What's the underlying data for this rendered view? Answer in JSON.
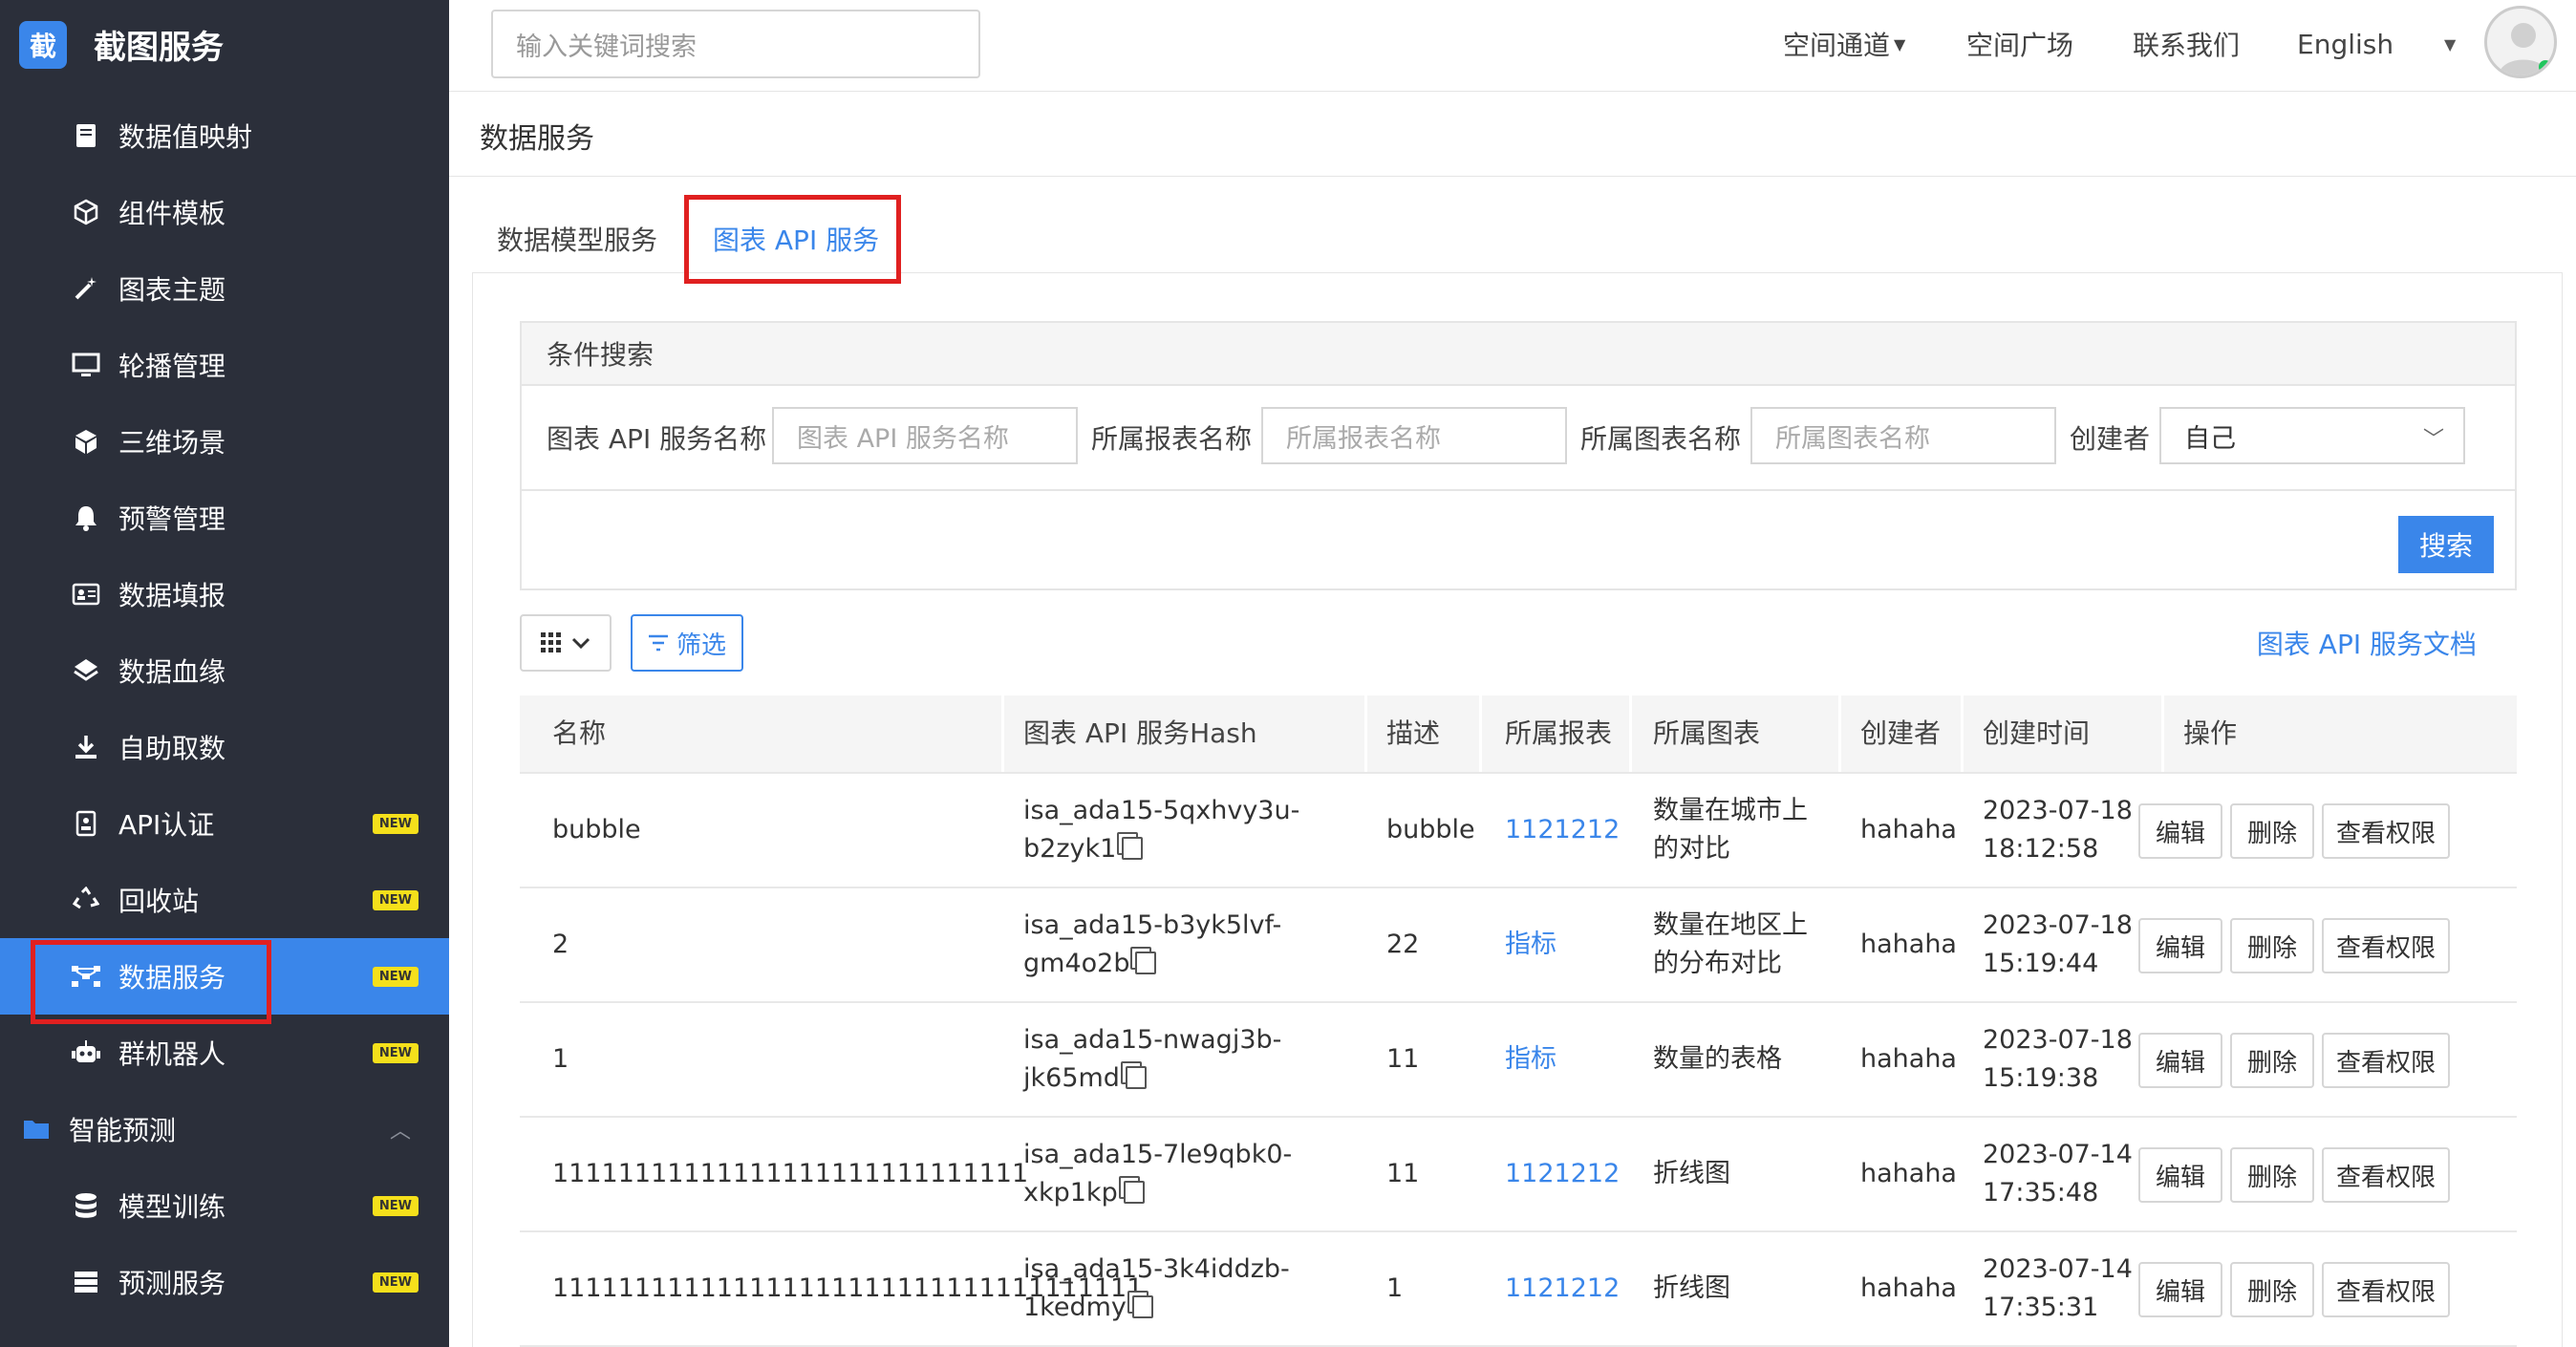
{
  "app": {
    "logo_char": "截",
    "name": "截图服务"
  },
  "sidebar": {
    "items": [
      {
        "label": "数据值映射",
        "icon": "book-icon",
        "badge": ""
      },
      {
        "label": "组件模板",
        "icon": "cube-outline-icon",
        "badge": ""
      },
      {
        "label": "图表主题",
        "icon": "magic-wand-icon",
        "badge": ""
      },
      {
        "label": "轮播管理",
        "icon": "monitor-icon",
        "badge": ""
      },
      {
        "label": "三维场景",
        "icon": "cube-icon",
        "badge": ""
      },
      {
        "label": "预警管理",
        "icon": "bell-icon",
        "badge": ""
      },
      {
        "label": "数据填报",
        "icon": "id-card-icon",
        "badge": ""
      },
      {
        "label": "数据血缘",
        "icon": "layers-icon",
        "badge": ""
      },
      {
        "label": "自助取数",
        "icon": "download-icon",
        "badge": ""
      },
      {
        "label": "API认证",
        "icon": "badge-icon",
        "badge": "NEW"
      },
      {
        "label": "回收站",
        "icon": "recycle-icon",
        "badge": "NEW"
      },
      {
        "label": "数据服务",
        "icon": "network-icon",
        "badge": "NEW"
      },
      {
        "label": "群机器人",
        "icon": "robot-icon",
        "badge": "NEW"
      },
      {
        "label": "智能预测",
        "icon": "folder-icon",
        "badge": ""
      },
      {
        "label": "模型训练",
        "icon": "database-icon",
        "badge": "NEW"
      },
      {
        "label": "预测服务",
        "icon": "server-icon",
        "badge": "NEW"
      }
    ]
  },
  "topbar": {
    "search_placeholder": "输入关键词搜索",
    "nav": [
      "空间通道",
      "空间广场",
      "联系我们",
      "English"
    ]
  },
  "page": {
    "title": "数据服务",
    "tabs": [
      "数据模型服务",
      "图表 API 服务"
    ]
  },
  "search_panel": {
    "title": "条件搜索",
    "fields": [
      {
        "label": "图表 API 服务名称",
        "placeholder": "图表 API 服务名称"
      },
      {
        "label": "所属报表名称",
        "placeholder": "所属报表名称"
      },
      {
        "label": "所属图表名称",
        "placeholder": "所属图表名称"
      },
      {
        "label": "创建者",
        "value": "自己"
      }
    ],
    "search_button": "搜索"
  },
  "toolbar": {
    "filter_label": "筛选",
    "doc_link": "图表 API 服务文档"
  },
  "table": {
    "headers": [
      "名称",
      "图表 API 服务Hash",
      "描述",
      "所属报表",
      "所属图表",
      "创建者",
      "创建时间",
      "操作"
    ],
    "actions": [
      "编辑",
      "删除",
      "查看权限"
    ],
    "rows": [
      {
        "name": "bubble",
        "hash1": "isa_ada15-5qxhvy3u-",
        "hash2": "b2zyk1",
        "desc": "bubble",
        "report": "1121212",
        "chart1": "数量在城市上",
        "chart2": "的对比",
        "creator": "hahaha",
        "date": "2023-07-18",
        "time": "18:12:58"
      },
      {
        "name": "2",
        "hash1": "isa_ada15-b3yk5lvf-",
        "hash2": "gm4o2b",
        "desc": "22",
        "report": "指标",
        "chart1": "数量在地区上",
        "chart2": "的分布对比",
        "creator": "hahaha",
        "date": "2023-07-18",
        "time": "15:19:44"
      },
      {
        "name": "1",
        "hash1": "isa_ada15-nwagj3b-",
        "hash2": "jk65md",
        "desc": "11",
        "report": "指标",
        "chart1": "数量的表格",
        "chart2": "",
        "creator": "hahaha",
        "date": "2023-07-18",
        "time": "15:19:38"
      },
      {
        "name": "11111111111111111111111111111",
        "hash1": "isa_ada15-7le9qbk0-",
        "hash2": "xkp1kp",
        "desc": "11",
        "report": "1121212",
        "chart1": "折线图",
        "chart2": "",
        "creator": "hahaha",
        "date": "2023-07-14",
        "time": "17:35:48"
      },
      {
        "name": "111111111111111111111111111111111111",
        "hash1": "isa_ada15-3k4iddzb-",
        "hash2": "1kedmy",
        "desc": "1",
        "report": "1121212",
        "chart1": "折线图",
        "chart2": "",
        "creator": "hahaha",
        "date": "2023-07-14",
        "time": "17:35:31"
      }
    ]
  },
  "colors": {
    "accent": "#3a86ea",
    "sidebar_bg": "#2b2f3a",
    "highlight": "#e02020",
    "badge": "#f5e01b"
  }
}
